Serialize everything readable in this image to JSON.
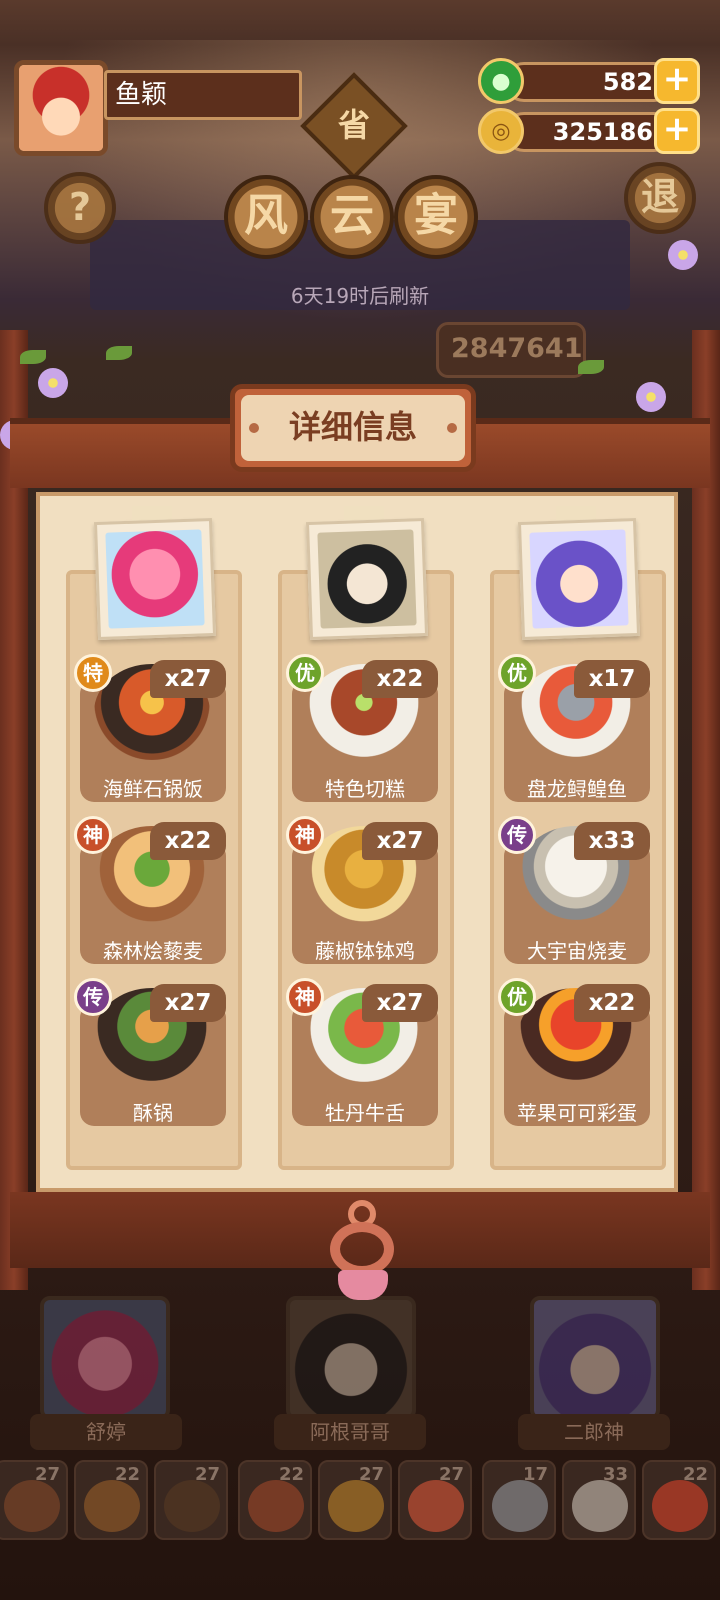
{
  "player": {
    "name": "鱼颖"
  },
  "currency": {
    "jade": "582",
    "coins": "325186"
  },
  "title_chars": [
    "风",
    "云",
    "宴"
  ],
  "province_char": "省",
  "refresh_text": "6天19时后刷新",
  "score_text": "2847641",
  "buttons": {
    "help": "?",
    "exit": "退"
  },
  "panel_title": "详细信息",
  "chefs": [
    {
      "name": "舒婷",
      "dishes": [
        {
          "name": "海鲜石锅饭",
          "count": "x27",
          "grade": "特"
        },
        {
          "name": "森林烩藜麦",
          "count": "x22",
          "grade": "神"
        },
        {
          "name": "酥锅",
          "count": "x27",
          "grade": "传"
        }
      ]
    },
    {
      "name": "阿根哥哥",
      "dishes": [
        {
          "name": "特色切糕",
          "count": "x22",
          "grade": "优"
        },
        {
          "name": "藤椒钵钵鸡",
          "count": "x27",
          "grade": "神"
        },
        {
          "name": "牡丹牛舌",
          "count": "x27",
          "grade": "神"
        }
      ]
    },
    {
      "name": "二郎神",
      "dishes": [
        {
          "name": "盘龙鲟鳇鱼",
          "count": "x17",
          "grade": "优"
        },
        {
          "name": "大宇宙烧麦",
          "count": "x33",
          "grade": "传"
        },
        {
          "name": "苹果可可彩蛋",
          "count": "x22",
          "grade": "优"
        }
      ]
    }
  ],
  "tray_counts": [
    "27",
    "22",
    "27",
    "22",
    "27",
    "27",
    "17",
    "33",
    "22"
  ],
  "colors": {
    "grade_te": "#e08a1a",
    "grade_you": "#6ea32a",
    "grade_shen": "#c8502a",
    "grade_chuan": "#7a3f8a",
    "accent": "#f6b82e"
  },
  "icons": {
    "jade": "jade-icon",
    "coin": "coin-icon",
    "plus": "plus-icon"
  }
}
